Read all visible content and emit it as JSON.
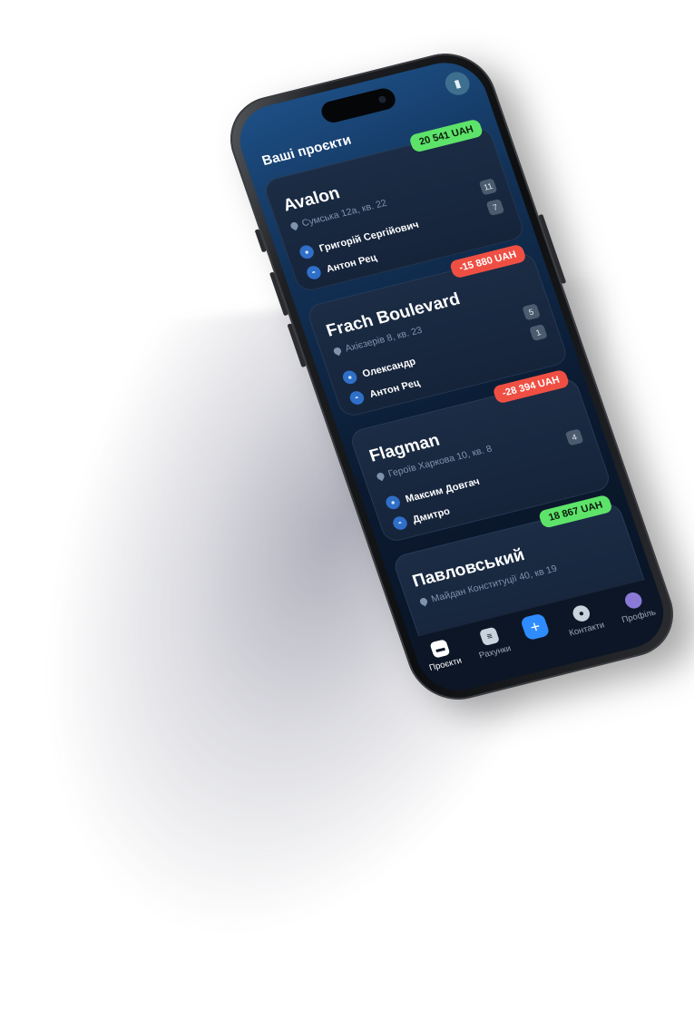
{
  "header": {
    "title": "Ваші проєкти",
    "corner_icon": "panels-icon"
  },
  "projects": [
    {
      "name": "Avalon",
      "address": "Сумська 12а, кв. 22",
      "amount": "20 541 UAH",
      "amount_color": "#5ee36a",
      "counts": [
        "11",
        "7"
      ],
      "people": [
        "Григорій Сергійович",
        "Антон Рец"
      ]
    },
    {
      "name": "Frach Boulevard",
      "address": "Ахієзерів 8, кв. 23",
      "amount": "-15 880 UAH",
      "amount_color": "#ef4f43",
      "counts": [
        "5",
        "1"
      ],
      "people": [
        "Олександр",
        "Антон Рец"
      ]
    },
    {
      "name": "Flagman",
      "address": "Героїв Харкова 10, кв. 8",
      "amount": "-28 394 UAH",
      "amount_color": "#ef4f43",
      "counts": [
        "4"
      ],
      "people": [
        "Максим Довгач",
        "Дмитро"
      ]
    },
    {
      "name": "Павловський",
      "address": "Майдан Конституції 40, кв 19",
      "amount": "18 867 UAH",
      "amount_color": "#5ee36a",
      "counts": [],
      "people": []
    }
  ],
  "tabbar": {
    "items": [
      {
        "label": "Проєкти",
        "icon": "folder-icon"
      },
      {
        "label": "Рахунки",
        "icon": "document-icon"
      },
      {
        "label": "",
        "icon": "plus-icon"
      },
      {
        "label": "Контакти",
        "icon": "user-circle-icon"
      },
      {
        "label": "Профіль",
        "icon": "avatar-icon"
      }
    ]
  }
}
